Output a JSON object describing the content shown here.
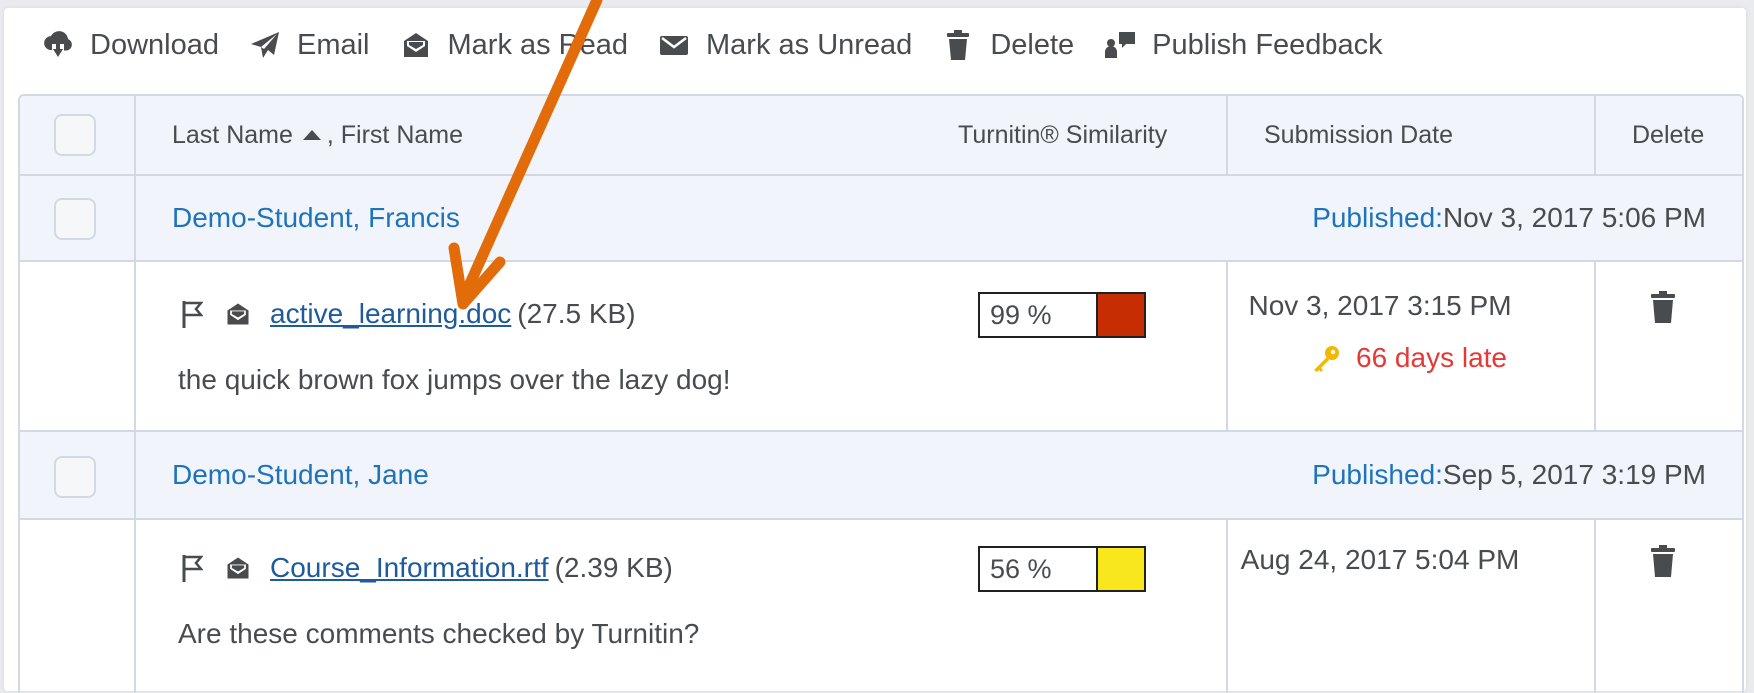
{
  "toolbar": {
    "download_label": "Download",
    "email_label": "Email",
    "mark_read_label": "Mark as Read",
    "mark_unread_label": "Mark as Unread",
    "delete_label": "Delete",
    "publish_feedback_label": "Publish Feedback"
  },
  "table": {
    "col_name": "Last Name",
    "col_name_sort_icon": "sort-up-triangle",
    "col_name_first": ", First Name",
    "col_similarity": "Turnitin® Similarity",
    "col_submission_date": "Submission Date",
    "col_delete": "Delete"
  },
  "students": [
    {
      "name": "Demo-Student, Francis",
      "published_label": "Published:",
      "published_date": "Nov 3, 2017 5:06 PM",
      "file_name": "active_learning.doc",
      "file_size": "(27.5 KB)",
      "comment": "the quick brown fox jumps over the lazy dog!",
      "similarity": "99 %",
      "similarity_color": "#c62d03",
      "submission_date": "Nov 3, 2017 3:15 PM",
      "late_text": "66 days late"
    },
    {
      "name": "Demo-Student, Jane",
      "published_label": "Published:",
      "published_date": "Sep 5, 2017 3:19 PM",
      "file_name": "Course_Information.rtf",
      "file_size": "(2.39 KB)",
      "comment": "Are these comments checked by Turnitin?",
      "similarity": "56 %",
      "similarity_color": "#f8e71c",
      "submission_date": "Aug 24, 2017 5:04 PM"
    }
  ],
  "colors": {
    "link": "#1e74bb",
    "late": "#e53935",
    "annotation_arrow": "#e36c0a"
  },
  "icons": {
    "download": "cloud-download-icon",
    "email": "paper-plane-icon",
    "mark_read": "envelope-open-icon",
    "mark_unread": "envelope-icon",
    "delete": "trash-icon",
    "publish_feedback": "publish-feedback-icon",
    "flag": "flag-icon",
    "read_status": "read-envelope-icon",
    "late": "key-icon"
  }
}
